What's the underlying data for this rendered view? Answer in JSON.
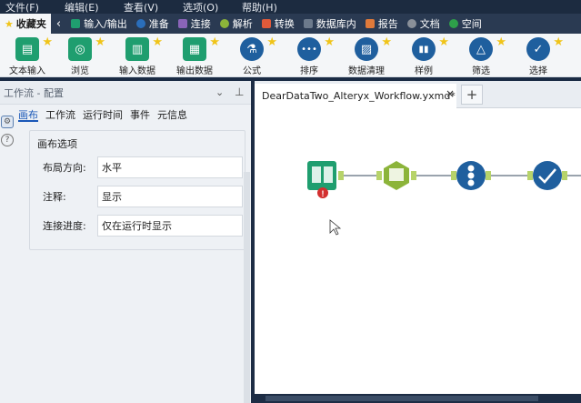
{
  "menu": [
    "文件(F)",
    "编辑(E)",
    "查看(V)",
    "选项(O)",
    "帮助(H)"
  ],
  "categories": [
    {
      "label": "收藏夹",
      "color": "#f0c419",
      "active": true
    },
    {
      "label": "输入/输出",
      "color": "#1f9e6f"
    },
    {
      "label": "准备",
      "color": "#2a6ebb"
    },
    {
      "label": "连接",
      "color": "#8a64b8"
    },
    {
      "label": "解析",
      "color": "#8cb43a"
    },
    {
      "label": "转换",
      "color": "#e05a3a"
    },
    {
      "label": "数据库内",
      "color": "#6c7a8c"
    },
    {
      "label": "报告",
      "color": "#e07a3a"
    },
    {
      "label": "文档",
      "color": "#8a9099"
    },
    {
      "label": "空间",
      "color": "#2ea04a"
    }
  ],
  "tools": [
    {
      "label": "文本输入",
      "color": "#1f9e6f",
      "glyph": "▤"
    },
    {
      "label": "浏览",
      "color": "#1f9e6f",
      "glyph": "◎"
    },
    {
      "label": "输入数据",
      "color": "#1f9e6f",
      "glyph": "▥"
    },
    {
      "label": "输出数据",
      "color": "#1f9e6f",
      "glyph": "▦"
    },
    {
      "label": "公式",
      "color": "#1f5f9e",
      "glyph": "⚗"
    },
    {
      "label": "排序",
      "color": "#1f5f9e",
      "glyph": "•••"
    },
    {
      "label": "数据清理",
      "color": "#1f5f9e",
      "glyph": "▨"
    },
    {
      "label": "样例",
      "color": "#1f5f9e",
      "glyph": "▮▮"
    },
    {
      "label": "筛选",
      "color": "#1f5f9e",
      "glyph": "△"
    },
    {
      "label": "选择",
      "color": "#1f5f9e",
      "glyph": "✓"
    }
  ],
  "left_panel": {
    "title": "工作流 - 配置",
    "tabs": [
      "画布",
      "工作流",
      "运行时间",
      "事件",
      "元信息"
    ],
    "section_title": "画布选项",
    "fields": [
      {
        "label": "布局方向:",
        "value": "水平"
      },
      {
        "label": "注释:",
        "value": "显示"
      },
      {
        "label": "连接进度:",
        "value": "仅在运行时显示"
      }
    ]
  },
  "canvas": {
    "doc_tab": "DearDataTwo_Alteryx_Workflow.yxmd*",
    "new_tab": "+",
    "close": "×",
    "error_badge": "!"
  }
}
